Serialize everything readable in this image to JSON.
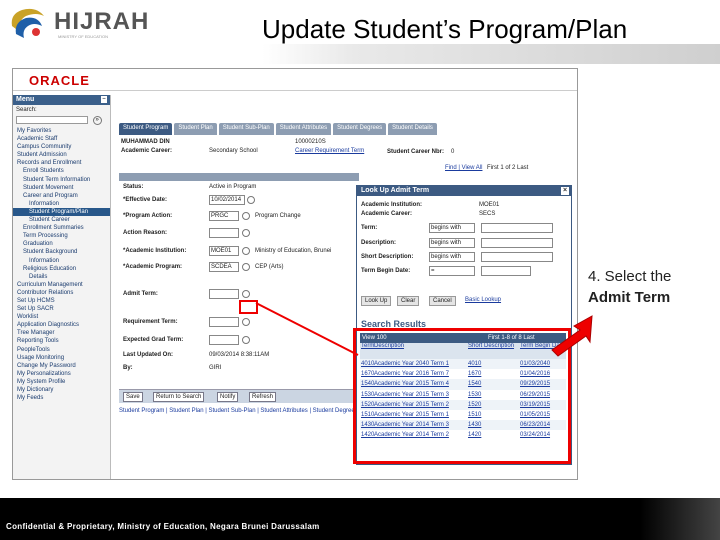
{
  "logo": {
    "text": "HIJRAH",
    "tagline": "MINISTRY OF EDUCATION"
  },
  "slide_title": "Update Student’s Program/Plan",
  "callout": {
    "line1": "4. Select the",
    "line2": "Admit Term"
  },
  "footer": "Confidential & Proprietary, Ministry of Education, Negara Brunei Darussalam",
  "app": {
    "brand": "ORACLE",
    "menu": {
      "title": "Menu",
      "search_label": "Search:",
      "items": [
        {
          "label": "My Favorites",
          "level": 1
        },
        {
          "label": "Academic Staff",
          "level": 1
        },
        {
          "label": "Campus Community",
          "level": 1
        },
        {
          "label": "Student Admission",
          "level": 1
        },
        {
          "label": "Records and Enrollment",
          "level": 1
        },
        {
          "label": "Enroll Students",
          "level": 2
        },
        {
          "label": "Student Term Information",
          "level": 2
        },
        {
          "label": "Student Movement",
          "level": 2
        },
        {
          "label": "Career and Program",
          "level": 2
        },
        {
          "label": "Information",
          "level": 3
        },
        {
          "label": "Student Program/Plan",
          "level": 3,
          "selected": true
        },
        {
          "label": "Student Career",
          "level": 3
        },
        {
          "label": "Enrollment Summaries",
          "level": 2
        },
        {
          "label": "Term Processing",
          "level": 2
        },
        {
          "label": "Graduation",
          "level": 2
        },
        {
          "label": "Student Background",
          "level": 2
        },
        {
          "label": "Information",
          "level": 3
        },
        {
          "label": "Religious Education",
          "level": 2
        },
        {
          "label": "Details",
          "level": 3
        },
        {
          "label": "Curriculum Management",
          "level": 1
        },
        {
          "label": "Contributor Relations",
          "level": 1
        },
        {
          "label": "Set Up HCMS",
          "level": 1
        },
        {
          "label": "Set Up SACR",
          "level": 1
        },
        {
          "label": "Worklist",
          "level": 1
        },
        {
          "label": "Application Diagnostics",
          "level": 1
        },
        {
          "label": "Tree Manager",
          "level": 1
        },
        {
          "label": "Reporting Tools",
          "level": 1
        },
        {
          "label": "PeopleTools",
          "level": 1
        },
        {
          "label": "Usage Monitoring",
          "level": 1
        },
        {
          "label": "Change My Password",
          "level": 1
        },
        {
          "label": "My Personalizations",
          "level": 1
        },
        {
          "label": "My System Profile",
          "level": 1
        },
        {
          "label": "My Dictionary",
          "level": 1
        },
        {
          "label": "My Feeds",
          "level": 1
        }
      ]
    },
    "tabs": [
      "Student Program",
      "Student Plan",
      "Student Sub-Plan",
      "Student Attributes",
      "Student Degrees",
      "Student Details"
    ],
    "student": {
      "name": "MUHAMMAD DIN",
      "id": "10000210S",
      "career_label": "Academic Career:",
      "career_value": "Secondary School",
      "career_req_link": "Career Requirement Term",
      "career_nbr_label": "Student Career Nbr:",
      "career_nbr_value": "0",
      "find": "Find | View All",
      "paging": "First 1 of 2 Last"
    },
    "form": {
      "status_label": "Status:",
      "status_value": "Active in Program",
      "effdate_label": "*Effective Date:",
      "effdate_value": "10/02/2014",
      "action_label": "*Program Action:",
      "action_value": "PRGC",
      "action_desc": "Program Change",
      "reason_label": "Action Reason:",
      "institution_label": "*Academic Institution:",
      "institution_value": "MOE01",
      "institution_desc": "Ministry of Education, Brunei",
      "program_label": "*Academic Program:",
      "program_value": "SCDEA",
      "program_desc": "CEP (Arts)",
      "admit_label": "Admit Term:",
      "req_term_label": "Requirement Term:",
      "exp_grad_label": "Expected Grad Term:",
      "updated_label": "Last Updated On:",
      "updated_value": "09/03/2014  8:38:11AM",
      "by_label": "By:",
      "by_value": "GIRI"
    },
    "buttons": {
      "save": "Save",
      "return": "Return to Search",
      "notify": "Notify",
      "refresh": "Refresh"
    },
    "footer_links": "Student Program | Student Plan | Student Sub-Plan | Student Attributes | Student Degrees | Student Details"
  },
  "popup": {
    "title": "Look Up Admit Term",
    "inst_label": "Academic Institution:",
    "inst_value": "MOE01",
    "career_label": "Academic Career:",
    "career_value": "SECS",
    "term_label": "Term:",
    "desc_label": "Description:",
    "sdesc_label": "Short Description:",
    "begin_label": "Term Begin Date:",
    "op_begins": "begins with",
    "op_eq": "=",
    "btn_lookup": "Look Up",
    "btn_clear": "Clear",
    "btn_cancel": "Cancel",
    "btn_basic": "Basic Lookup",
    "results_title": "Search Results",
    "grid_header": "View 100",
    "grid_paging": "First 1-8 of 8 Last",
    "columns": [
      "Term",
      "Description",
      "Short Description",
      "Term Begin Date"
    ],
    "rows": [
      [
        "4010",
        "Academic Year 2040 Term 1",
        "4010",
        "01/03/2040"
      ],
      [
        "1670",
        "Academic Year 2016 Term 7",
        "1670",
        "01/04/2016"
      ],
      [
        "1540",
        "Academic Year 2015 Term 4",
        "1540",
        "09/29/2015"
      ],
      [
        "1530",
        "Academic Year 2015 Term 3",
        "1530",
        "06/29/2015"
      ],
      [
        "1520",
        "Academic Year 2015 Term 2",
        "1520",
        "03/19/2015"
      ],
      [
        "1510",
        "Academic Year 2015 Term 1",
        "1510",
        "01/05/2015"
      ],
      [
        "1430",
        "Academic Year 2014 Term 3",
        "1430",
        "06/23/2014"
      ],
      [
        "1420",
        "Academic Year 2014 Term 2",
        "1420",
        "03/24/2014"
      ]
    ]
  }
}
